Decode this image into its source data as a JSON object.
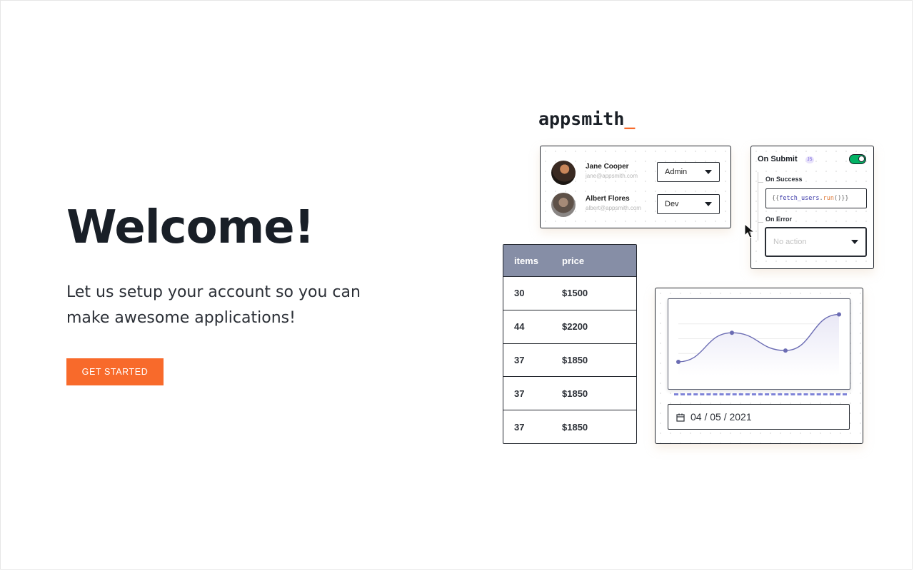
{
  "hero": {
    "title": "Welcome!",
    "subtitle": "Let us setup your account so you can make awesome applications!",
    "cta_label": "GET STARTED"
  },
  "brand": {
    "name": "appsmith",
    "cursor": "_"
  },
  "users_card": {
    "users": [
      {
        "name": "Jane Cooper",
        "email": "jane@appsmith.com",
        "role": "Admin"
      },
      {
        "name": "Albert Flores",
        "email": "albert@appsmith.com",
        "role": "Dev"
      }
    ]
  },
  "submit_card": {
    "title": "On Submit",
    "badge": "JS",
    "toggle_on": true,
    "on_success_label": "On Success",
    "code_prefix": "{{",
    "code_fn": "fetch_users",
    "code_dot": ".",
    "code_run": "run",
    "code_suffix": "()}}",
    "on_error_label": "On Error",
    "action_placeholder": "No action"
  },
  "table": {
    "columns": [
      "items",
      "price"
    ],
    "rows": [
      [
        "30",
        "$1500"
      ],
      [
        "44",
        "$2200"
      ],
      [
        "37",
        "$1850"
      ],
      [
        "37",
        "$1850"
      ],
      [
        "37",
        "$1850"
      ]
    ]
  },
  "chart_card": {
    "date": "04 / 05 / 2021",
    "date_icon": "calendar-icon"
  },
  "chart_data": {
    "type": "area",
    "x": [
      0,
      1,
      2,
      3
    ],
    "values": [
      12,
      66,
      33,
      100
    ],
    "ylim": [
      0,
      110
    ],
    "grid": true,
    "line_color": "#6b6cb3",
    "fill_color": "#e9e8f6"
  },
  "colors": {
    "accent": "#f86a2b",
    "table_header": "#868ea6",
    "toggle": "#03b365"
  }
}
